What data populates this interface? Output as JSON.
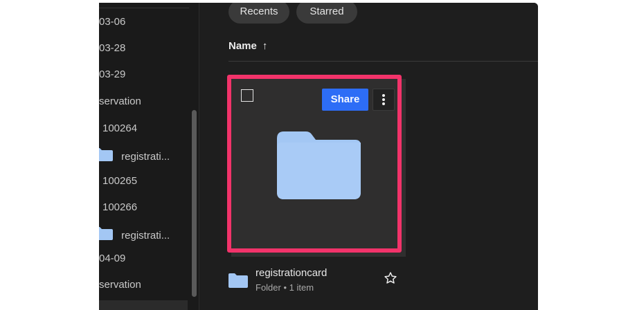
{
  "sidebar": {
    "items": [
      {
        "label": "03-06",
        "icon": null
      },
      {
        "label": "03-28",
        "icon": null
      },
      {
        "label": "03-29",
        "icon": null
      },
      {
        "label": "servation",
        "icon": null
      },
      {
        "label": "100264",
        "icon": null
      },
      {
        "label": "registrati...",
        "icon": "folder-icon"
      },
      {
        "label": "100265",
        "icon": null
      },
      {
        "label": "100266",
        "icon": null
      },
      {
        "label": "registrati...",
        "icon": "folder-icon"
      },
      {
        "label": "04-09",
        "icon": null
      },
      {
        "label": "servation",
        "icon": null
      }
    ]
  },
  "filters": {
    "recents_label": "Recents",
    "starred_label": "Starred"
  },
  "list": {
    "sort_column": "Name",
    "sort_icon": "arrow-up-icon"
  },
  "card": {
    "share_label": "Share",
    "more_icon": "more-vertical-icon",
    "folder_icon": "folder-icon",
    "highlight_color": "#f2336a"
  },
  "item": {
    "name": "registrationcard",
    "meta": "Folder • 1 item",
    "star_icon": "star-outline-icon"
  },
  "colors": {
    "accent": "#2d6df6",
    "folder": "#a3c7f4",
    "background": "#1e1e1e"
  }
}
